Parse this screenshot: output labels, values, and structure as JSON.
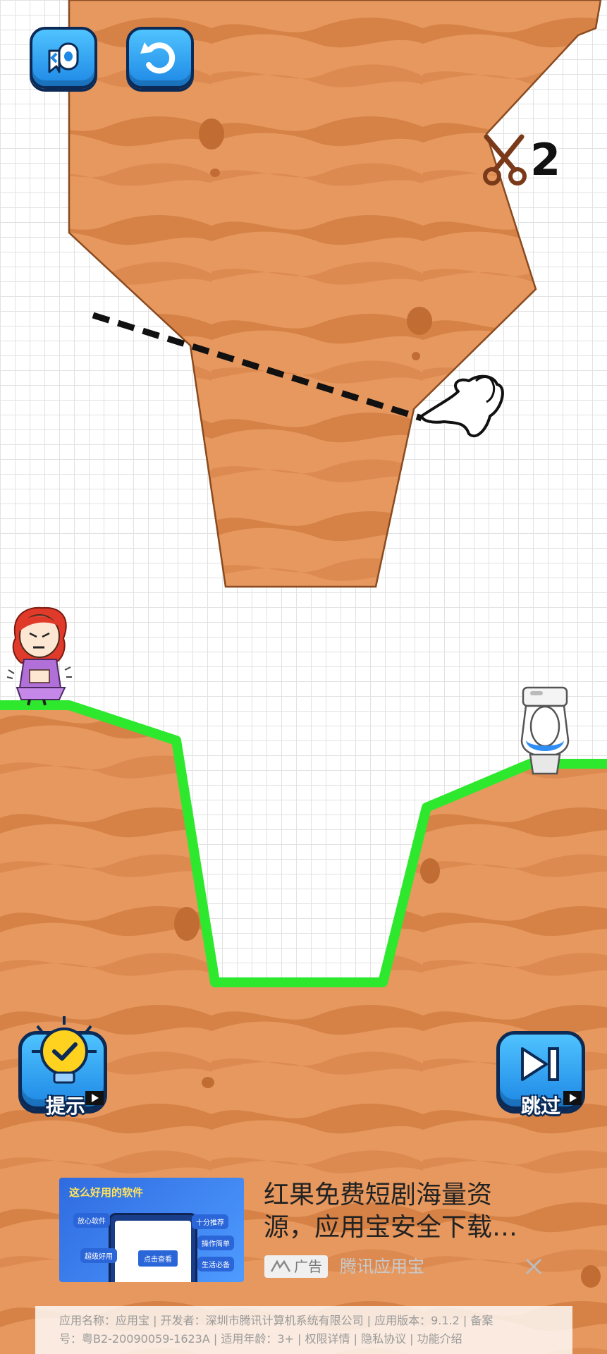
{
  "toolbar": {
    "skip_level_icon": "paper-roll-back-icon",
    "restart_icon": "restart-icon"
  },
  "cuts": {
    "icon": "scissors-icon",
    "count": "2"
  },
  "characters": {
    "girl_icon": "girl-character",
    "toilet_icon": "toilet-icon",
    "hand_icon": "pointing-hand-icon"
  },
  "buttons": {
    "hint_label": "提示",
    "skip_label": "跳过"
  },
  "ad": {
    "thumb_title": "这么好用的软件",
    "thumb_chips": [
      "放心软件",
      "十分推荐",
      "超级好用",
      "操作简单",
      "生活必备"
    ],
    "thumb_cta": "点击查看",
    "title_line1": "红果免费短剧海量资",
    "title_line2": "源，应用宝安全下载…",
    "badge": "广告",
    "source": "腾讯应用宝"
  },
  "footer": {
    "line1": "应用名称：应用宝 | 开发者：深圳市腾讯计算机系统有限公司 | 应用版本：9.1.2 | 备案",
    "line2": "号：粤B2-20090059-1623A | 适用年龄：3+ | 权限详情 | 隐私协议 | 功能介绍"
  },
  "colors": {
    "dirt": "#e6985e",
    "dirt_stripe": "#d68145",
    "outline": "#8a4a20",
    "ground_edge": "#2ee82e",
    "button_blue": "#1e88e5"
  }
}
